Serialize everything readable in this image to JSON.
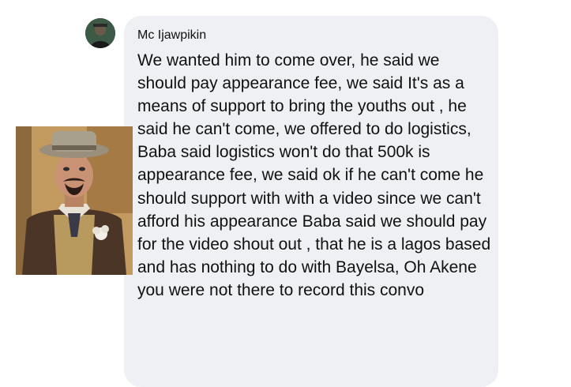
{
  "post": {
    "sender_name": "Mc Ijawpikin",
    "avatar_icon": "user-avatar-icon",
    "message_text": "We wanted him to come over, he said we should pay appearance fee, we said It's as a means of support to bring the youths out , he said he can't come, we offered to do logistics, Baba said logistics won't do that 500k is appearance fee, we said ok if he can't come he should support with with a video since we can't afford his appearance Baba said we should pay for the video shout out , that he is a lagos based and has nothing to do with Bayelsa, Oh Akene you were not there to record this convo"
  },
  "colors": {
    "bubble_background": "#eef0f3",
    "text": "#111111",
    "page_background": "#ffffff"
  }
}
